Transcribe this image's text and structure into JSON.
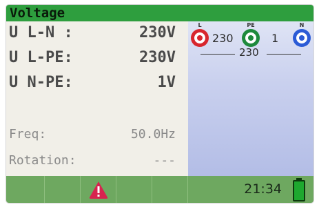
{
  "window": {
    "title": "Voltage"
  },
  "measurements": [
    {
      "label": "U L-N :",
      "value": "230V"
    },
    {
      "label": "U L-PE:",
      "value": "230V"
    },
    {
      "label": "U N-PE:",
      "value": "1V"
    }
  ],
  "secondary": [
    {
      "label": "Freq:",
      "value": "50.0Hz"
    },
    {
      "label": "Rotation:",
      "value": "---"
    }
  ],
  "terminal_diagram": {
    "terminals": [
      {
        "label": "L",
        "color": "#d8262e"
      },
      {
        "label": "PE",
        "color": "#1e8a3c"
      },
      {
        "label": "N",
        "color": "#2b5bd6"
      }
    ],
    "values": {
      "l_pe": "230",
      "pe_n": "1",
      "l_n": "230"
    }
  },
  "statusbar": {
    "time": "21:34",
    "warning_color": "#d8234f",
    "battery_color": "#1ea82f"
  }
}
